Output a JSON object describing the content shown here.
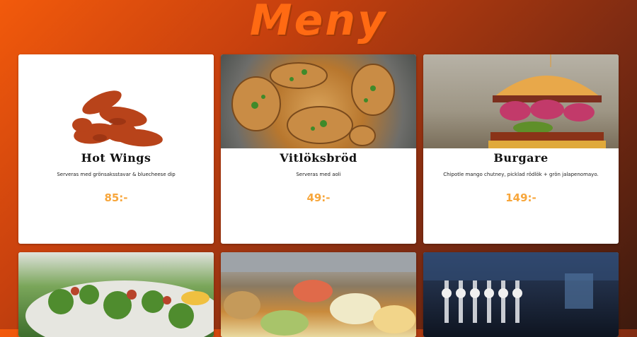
{
  "page": {
    "title": "Meny"
  },
  "menu": [
    {
      "name": "Hot Wings",
      "description": "Serveras med grönsaksstavar & bluecheese dip",
      "price": "85:-",
      "image": "wings-image"
    },
    {
      "name": "Vitlöksbröd",
      "description": "Serveras med aoli",
      "price": "49:-",
      "image": "garlic-bread-image"
    },
    {
      "name": "Burgare",
      "description": "Chipotle mango chutney, picklad rödlök + grön jalapenomayo.",
      "price": "149:-",
      "image": "burger-image"
    },
    {
      "name": "",
      "description": "",
      "price": "",
      "image": "salad-image"
    },
    {
      "name": "",
      "description": "",
      "price": "",
      "image": "deli-counter-image"
    },
    {
      "name": "",
      "description": "",
      "price": "",
      "image": "bar-taps-image"
    }
  ]
}
